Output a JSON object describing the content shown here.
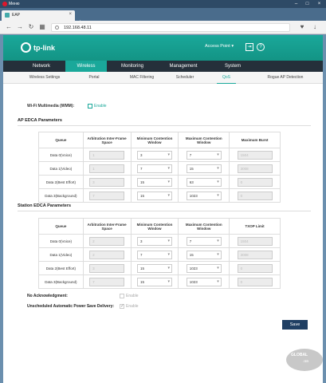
{
  "browser": {
    "menu_label": "Меню",
    "tab_title": "EAP",
    "url": "192.168.48.11"
  },
  "header": {
    "logo_text": "tp-link",
    "ap_mode": "Access Point"
  },
  "main_nav": [
    {
      "label": "Network"
    },
    {
      "label": "Wireless"
    },
    {
      "label": "Monitoring"
    },
    {
      "label": "Management"
    },
    {
      "label": "System"
    }
  ],
  "sub_nav": [
    {
      "label": "Wireless Settings"
    },
    {
      "label": "Portal"
    },
    {
      "label": "MAC Filtering"
    },
    {
      "label": "Scheduler"
    },
    {
      "label": "QoS"
    },
    {
      "label": "Rogue AP Detection"
    }
  ],
  "wmm": {
    "label": "Wi-Fi Multimedia (WMM):",
    "option": "Enable"
  },
  "ap_edca": {
    "title": "AP EDCA Parameters",
    "headers": [
      "Queue",
      "Arbitration Inter-Frame Space",
      "Minimum Contention Window",
      "Maximum Contention Window",
      "Maximum Burst"
    ],
    "rows": [
      {
        "queue": "Data 0(Voice)",
        "aifs": "1",
        "cwmin": "3",
        "cwmax": "7",
        "burst": "1504"
      },
      {
        "queue": "Data 1(Video)",
        "aifs": "1",
        "cwmin": "7",
        "cwmax": "15",
        "burst": "3008"
      },
      {
        "queue": "Data 2(Best Effort)",
        "aifs": "3",
        "cwmin": "15",
        "cwmax": "63",
        "burst": "0"
      },
      {
        "queue": "Data 3(Background)",
        "aifs": "7",
        "cwmin": "15",
        "cwmax": "1023",
        "burst": "0"
      }
    ]
  },
  "station_edca": {
    "title": "Station EDCA Parameters",
    "headers": [
      "Queue",
      "Arbitration Inter-Frame Space",
      "Minimum Contention Window",
      "Maximum Contention Window",
      "TXOP Limit"
    ],
    "rows": [
      {
        "queue": "Data 0(Voice)",
        "aifs": "2",
        "cwmin": "3",
        "cwmax": "7",
        "txop": "1504"
      },
      {
        "queue": "Data 1(Video)",
        "aifs": "2",
        "cwmin": "7",
        "cwmax": "15",
        "txop": "3008"
      },
      {
        "queue": "Data 2(Best Effort)",
        "aifs": "3",
        "cwmin": "15",
        "cwmax": "1023",
        "txop": "0"
      },
      {
        "queue": "Data 3(Background)",
        "aifs": "7",
        "cwmin": "15",
        "cwmax": "1023",
        "txop": "0"
      }
    ]
  },
  "no_ack": {
    "label": "No Acknowledgment:",
    "option": "Enable"
  },
  "apsd": {
    "label": "Unscheduled Automatic Power Save Delivery:",
    "option": "Enable"
  },
  "save_label": "Save",
  "watermark": {
    "text": "GLOBAL",
    "suffix": ".ua"
  },
  "colors": {
    "brand_teal": "#1aa89a",
    "nav_dark": "#25303a",
    "save_button": "#1f3f63"
  }
}
